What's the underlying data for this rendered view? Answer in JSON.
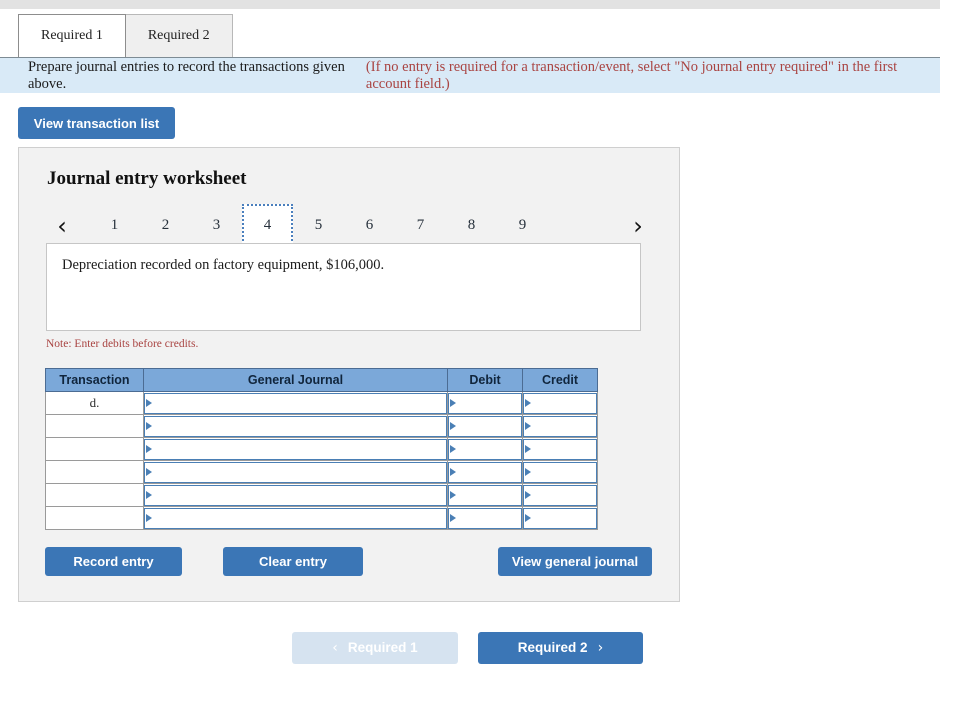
{
  "tabs": [
    {
      "label": "Required 1",
      "active": true
    },
    {
      "label": "Required 2",
      "active": false
    }
  ],
  "banner": {
    "text": "Prepare journal entries to record the transactions given above.",
    "hint": "(If no entry is required for a transaction/event, select \"No journal entry required\" in the first account field.)"
  },
  "toolbar": {
    "view_transaction_list": "View transaction list"
  },
  "worksheet": {
    "title": "Journal entry worksheet",
    "pager": {
      "prev_icon": "chevron-left",
      "next_icon": "chevron-right",
      "prev_glyph": "‹",
      "next_glyph": "›",
      "pages": [
        "1",
        "2",
        "3",
        "4",
        "5",
        "6",
        "7",
        "8",
        "9"
      ],
      "active_page": "4"
    },
    "description": "Depreciation recorded on factory equipment, $106,000.",
    "note": "Note: Enter debits before credits.",
    "table": {
      "headers": [
        "Transaction",
        "General Journal",
        "Debit",
        "Credit"
      ],
      "rows": [
        {
          "transaction": "d.",
          "general_journal": "",
          "debit": "",
          "credit": ""
        },
        {
          "transaction": "",
          "general_journal": "",
          "debit": "",
          "credit": ""
        },
        {
          "transaction": "",
          "general_journal": "",
          "debit": "",
          "credit": ""
        },
        {
          "transaction": "",
          "general_journal": "",
          "debit": "",
          "credit": ""
        },
        {
          "transaction": "",
          "general_journal": "",
          "debit": "",
          "credit": ""
        },
        {
          "transaction": "",
          "general_journal": "",
          "debit": "",
          "credit": ""
        }
      ]
    },
    "actions": {
      "record_entry": "Record entry",
      "clear_entry": "Clear entry",
      "view_general_journal": "View general journal"
    }
  },
  "bottom_nav": {
    "prev_label": "Required 1",
    "prev_glyph": "‹",
    "next_label": "Required 2",
    "next_glyph": "›"
  },
  "colors": {
    "primary_button": "#3b76b6",
    "disabled_button": "#d6e3f0",
    "banner_bg": "#d9eaf7",
    "table_header_bg": "#7ba8d9",
    "input_border": "#4a7fb5",
    "note_text": "#a94442"
  }
}
